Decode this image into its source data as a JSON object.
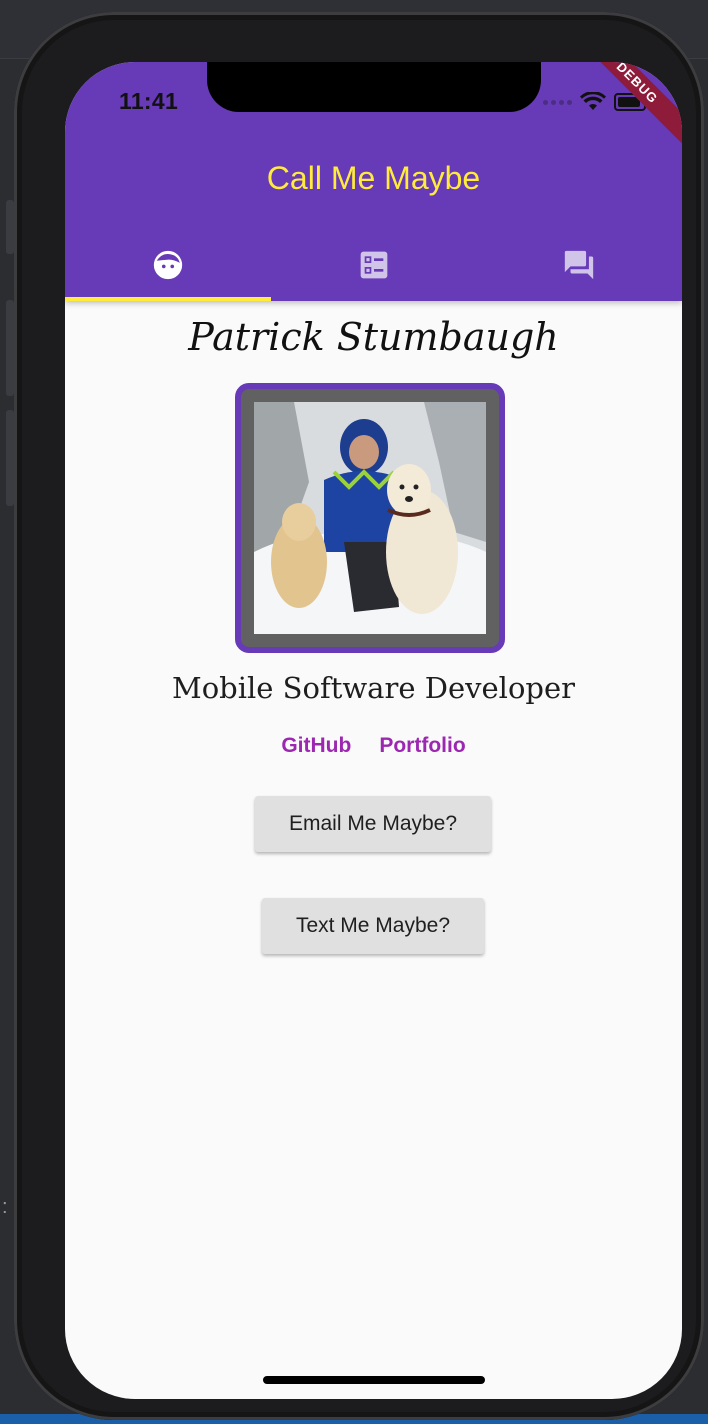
{
  "status_bar": {
    "time": "11:41",
    "debug_label": "DEBUG"
  },
  "app_bar": {
    "title": "Call Me Maybe",
    "tabs": [
      {
        "icon": "face-icon",
        "active": true
      },
      {
        "icon": "list-alt-icon",
        "active": false
      },
      {
        "icon": "question-answer-icon",
        "active": false
      }
    ]
  },
  "profile": {
    "name": "Patrick Stumbaugh",
    "photo_description_icon": "profile-photo",
    "title": "Mobile Software Developer",
    "links": {
      "github": "GitHub",
      "portfolio": "Portfolio"
    }
  },
  "actions": {
    "email_label": "Email Me Maybe?",
    "text_label": "Text Me Maybe?"
  },
  "colors": {
    "primary": "#673ab7",
    "accent": "#ffeb3b",
    "link": "#9c27b0",
    "button_bg": "#e0e0e0"
  }
}
